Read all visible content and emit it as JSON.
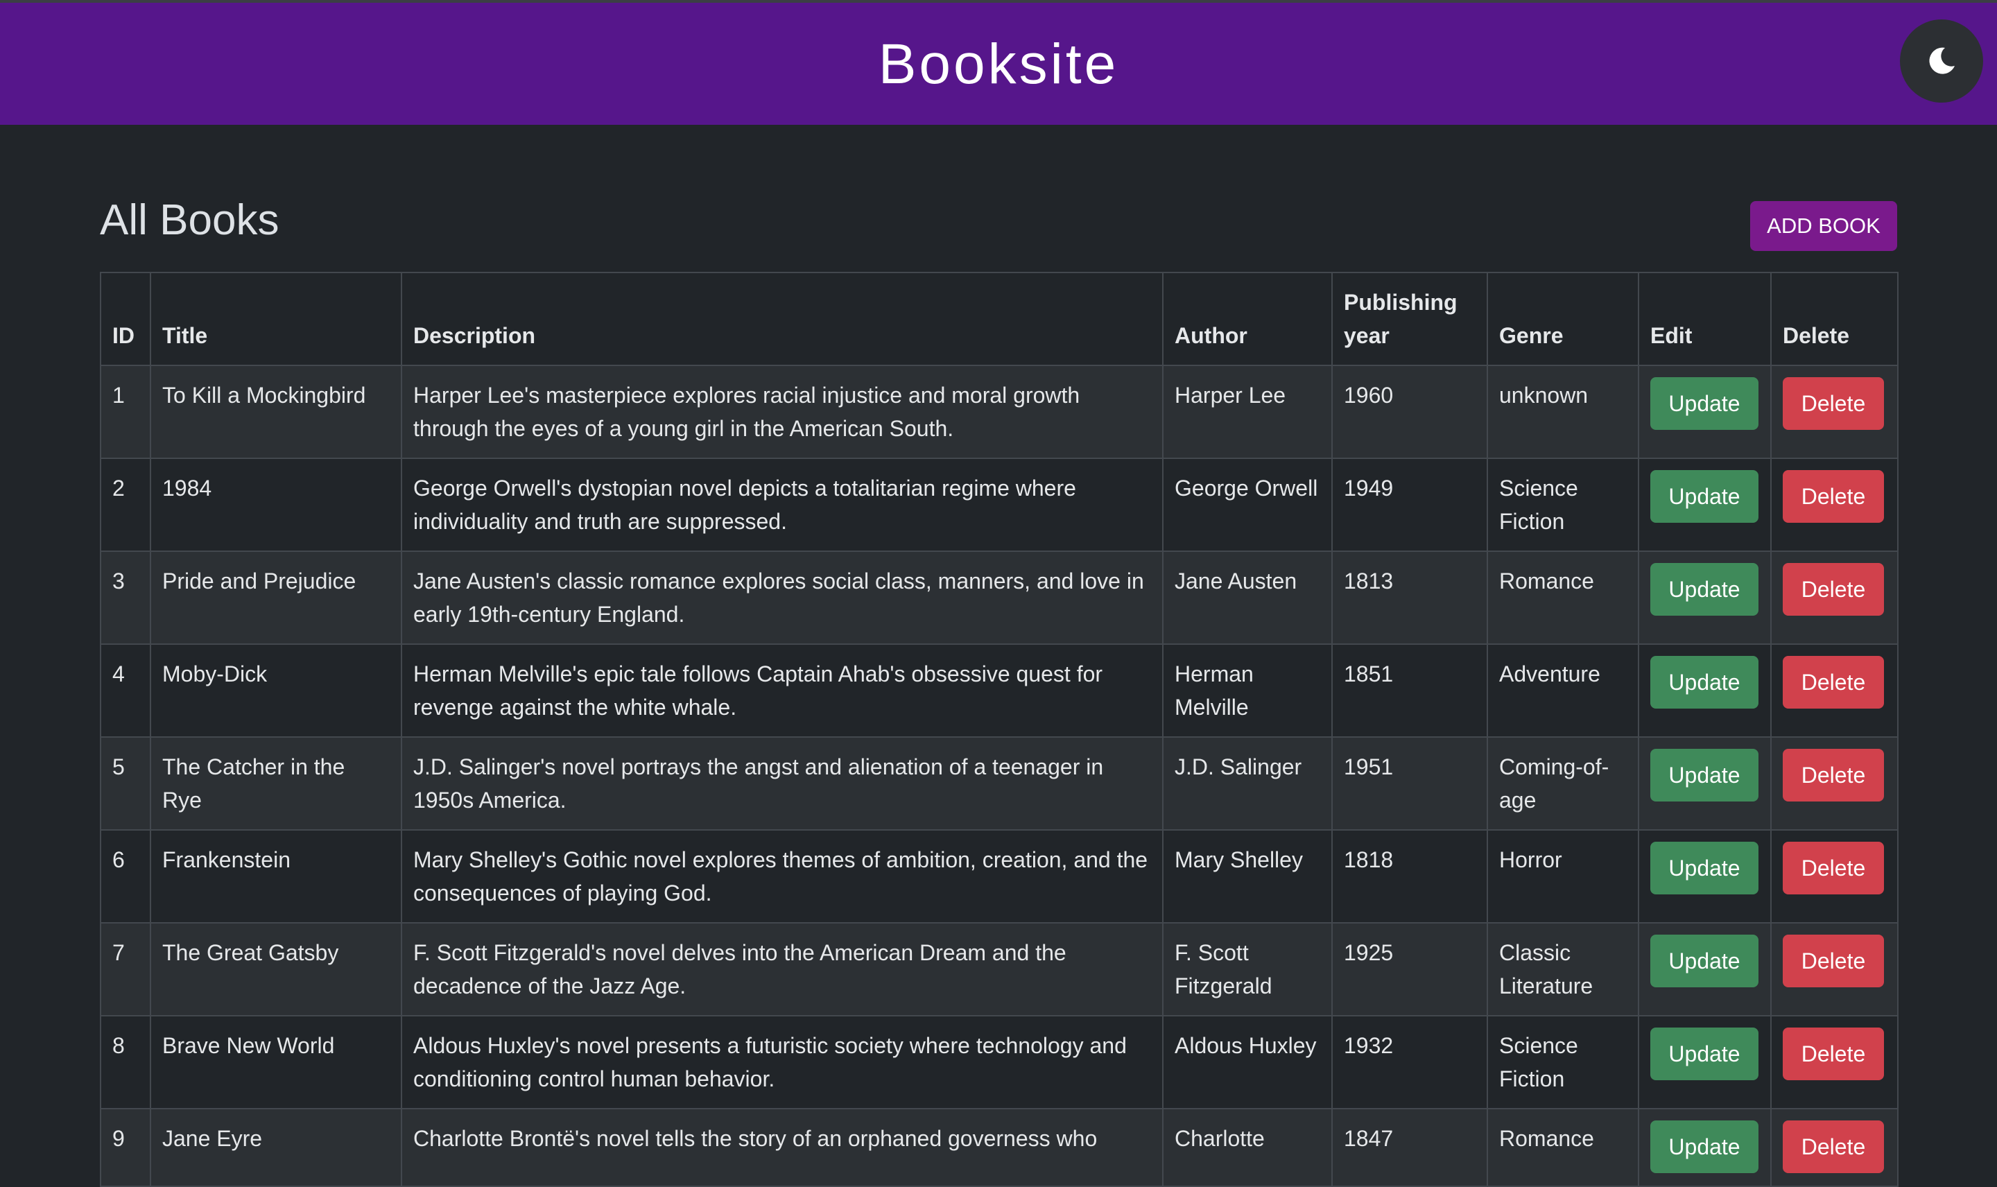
{
  "header": {
    "brand": "Booksite",
    "theme_toggle_icon": "moon-icon"
  },
  "main": {
    "title": "All Books",
    "add_button": "ADD BOOK"
  },
  "table": {
    "columns": [
      "ID",
      "Title",
      "Description",
      "Author",
      "Publishing year",
      "Genre",
      "Edit",
      "Delete"
    ],
    "rows": [
      {
        "id": "1",
        "title": "To Kill a Mockingbird",
        "description": "Harper Lee's masterpiece explores racial injustice and moral growth through the eyes of a young girl in the American South.",
        "author": "Harper Lee",
        "year": "1960",
        "genre": "unknown",
        "update": "Update",
        "delete": "Delete"
      },
      {
        "id": "2",
        "title": "1984",
        "description": "George Orwell's dystopian novel depicts a totalitarian regime where individuality and truth are suppressed.",
        "author": "George Orwell",
        "year": "1949",
        "genre": "Science Fiction",
        "update": "Update",
        "delete": "Delete"
      },
      {
        "id": "3",
        "title": "Pride and Prejudice",
        "description": "Jane Austen's classic romance explores social class, manners, and love in early 19th-century England.",
        "author": "Jane Austen",
        "year": "1813",
        "genre": "Romance",
        "update": "Update",
        "delete": "Delete"
      },
      {
        "id": "4",
        "title": "Moby-Dick",
        "description": "Herman Melville's epic tale follows Captain Ahab's obsessive quest for revenge against the white whale.",
        "author": "Herman Melville",
        "year": "1851",
        "genre": "Adventure",
        "update": "Update",
        "delete": "Delete"
      },
      {
        "id": "5",
        "title": "The Catcher in the Rye",
        "description": "J.D. Salinger's novel portrays the angst and alienation of a teenager in 1950s America.",
        "author": "J.D. Salinger",
        "year": "1951",
        "genre": "Coming-of-age",
        "update": "Update",
        "delete": "Delete"
      },
      {
        "id": "6",
        "title": "Frankenstein",
        "description": "Mary Shelley's Gothic novel explores themes of ambition, creation, and the consequences of playing God.",
        "author": "Mary Shelley",
        "year": "1818",
        "genre": "Horror",
        "update": "Update",
        "delete": "Delete"
      },
      {
        "id": "7",
        "title": "The Great Gatsby",
        "description": "F. Scott Fitzgerald's novel delves into the American Dream and the decadence of the Jazz Age.",
        "author": "F. Scott Fitzgerald",
        "year": "1925",
        "genre": "Classic Literature",
        "update": "Update",
        "delete": "Delete"
      },
      {
        "id": "8",
        "title": "Brave New World",
        "description": "Aldous Huxley's novel presents a futuristic society where technology and conditioning control human behavior.",
        "author": "Aldous Huxley",
        "year": "1932",
        "genre": "Science Fiction",
        "update": "Update",
        "delete": "Delete"
      },
      {
        "id": "9",
        "title": "Jane Eyre",
        "description": "Charlotte Brontë's novel tells the story of an orphaned governess who",
        "author": "Charlotte",
        "year": "1847",
        "genre": "Romance",
        "update": "Update",
        "delete": "Delete"
      }
    ]
  },
  "colors": {
    "header_bg": "#56168b",
    "page_bg": "#212529",
    "add_button_bg": "#7a1a8c",
    "update_button_bg": "#3f8a5a",
    "delete_button_bg": "#d1414c"
  }
}
